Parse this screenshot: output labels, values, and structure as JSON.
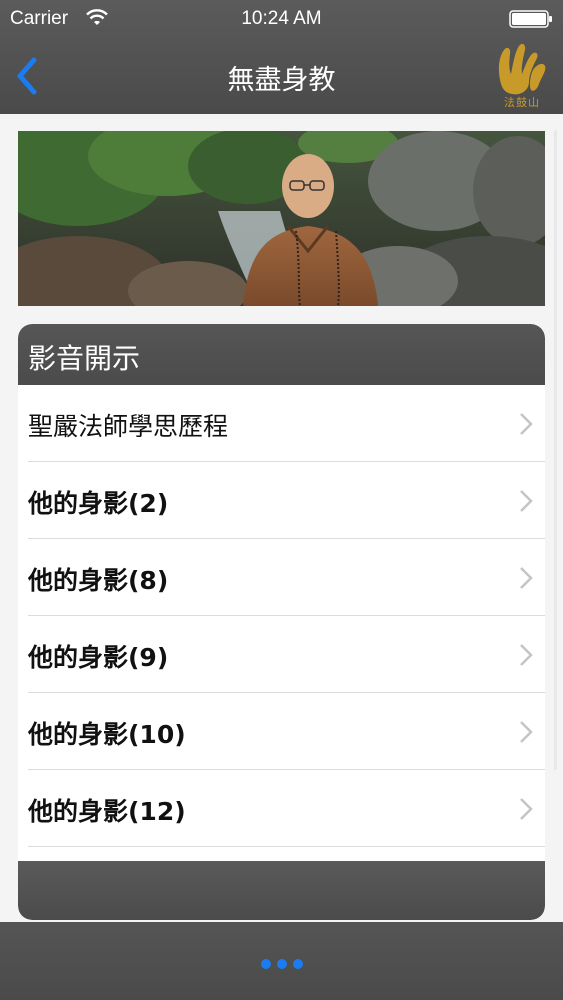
{
  "status_bar": {
    "carrier": "Carrier",
    "time": "10:24 AM"
  },
  "nav": {
    "title": "無盡身教",
    "logo_text": "法鼓山",
    "accent_color": "#1a7cf0",
    "logo_color": "#c79a2a"
  },
  "section": {
    "title": "影音開示",
    "items": [
      {
        "label": "聖嚴法師學思歷程"
      },
      {
        "label": "他的身影(2)"
      },
      {
        "label": "他的身影(8)"
      },
      {
        "label": "他的身影(9)"
      },
      {
        "label": "他的身影(10)"
      },
      {
        "label": "他的身影(12)"
      }
    ]
  },
  "icons": {
    "back": "chevron-left-icon",
    "row": "chevron-right-icon",
    "status": [
      "wifi-icon",
      "battery-icon"
    ]
  }
}
